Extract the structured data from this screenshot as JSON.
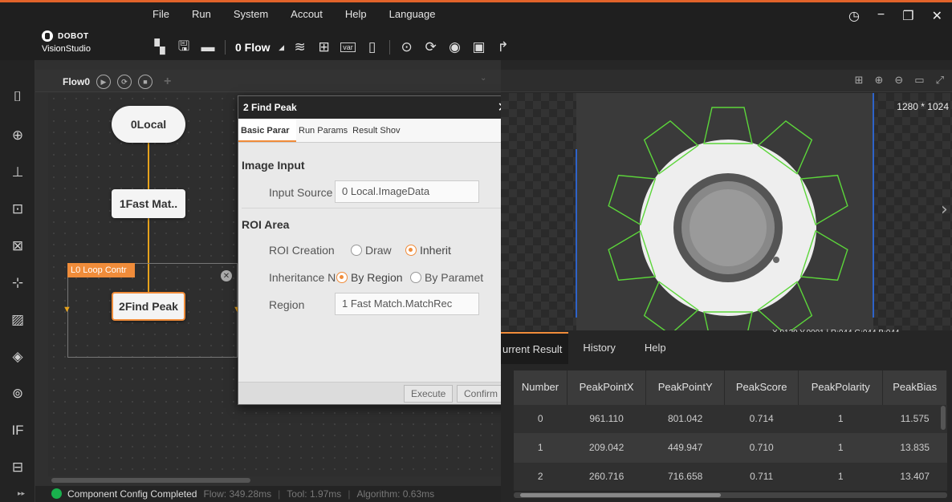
{
  "app": {
    "brand": "DOBOT",
    "product": "VisionStudio",
    "accent_color": "#e2632a"
  },
  "menu": [
    "File",
    "Run",
    "System",
    "Accout",
    "Help",
    "Language"
  ],
  "toolbar": {
    "flow_label": "0 Flow",
    "var_label": "var"
  },
  "flow": {
    "tab_label": "Flow0",
    "nodes": {
      "local": "0Local",
      "fast_match": "1Fast Mat..",
      "find_peak": "2Find Peak"
    },
    "loop_label": "L0 Loop Contr"
  },
  "dialog": {
    "title": "2 Find Peak",
    "tabs": [
      "Basic Parar",
      "Run Params",
      "Result Shov"
    ],
    "image_input": {
      "section": "Image Input",
      "source_label": "Input Source",
      "source_value": "0 Local.ImageData"
    },
    "roi": {
      "section": "ROI Area",
      "creation_label": "ROI Creation",
      "creation_opt1": "Draw",
      "creation_opt2": "Inherit",
      "inherit_label": "Inheritance N",
      "inherit_opt1": "By Region",
      "inherit_opt2": "By Paramet",
      "region_label": "Region",
      "region_value": "1 Fast Match.MatchRec"
    },
    "execute_label": "Execute",
    "confirm_label": "Confirm"
  },
  "viewer": {
    "resolution": "1280 * 1024",
    "pixel_info": "X,0129 Y,0001 | R:044 G:044 B:044"
  },
  "results": {
    "tabs": [
      "urrent Result",
      "History",
      "Help"
    ],
    "columns": [
      "Number",
      "PeakPointX",
      "PeakPointY",
      "PeakScore",
      "PeakPolarity",
      "PeakBias"
    ],
    "rows": [
      [
        "0",
        "961.110",
        "801.042",
        "0.714",
        "1",
        "11.575"
      ],
      [
        "1",
        "209.042",
        "449.947",
        "0.710",
        "1",
        "13.835"
      ],
      [
        "2",
        "260.716",
        "716.658",
        "0.711",
        "1",
        "13.407"
      ]
    ]
  },
  "status": {
    "message": "Component Config Completed",
    "flow_time": "Flow: 349.28ms",
    "tool_time": "Tool: 1.97ms",
    "algo_time": "Algorithm: 0.63ms"
  }
}
